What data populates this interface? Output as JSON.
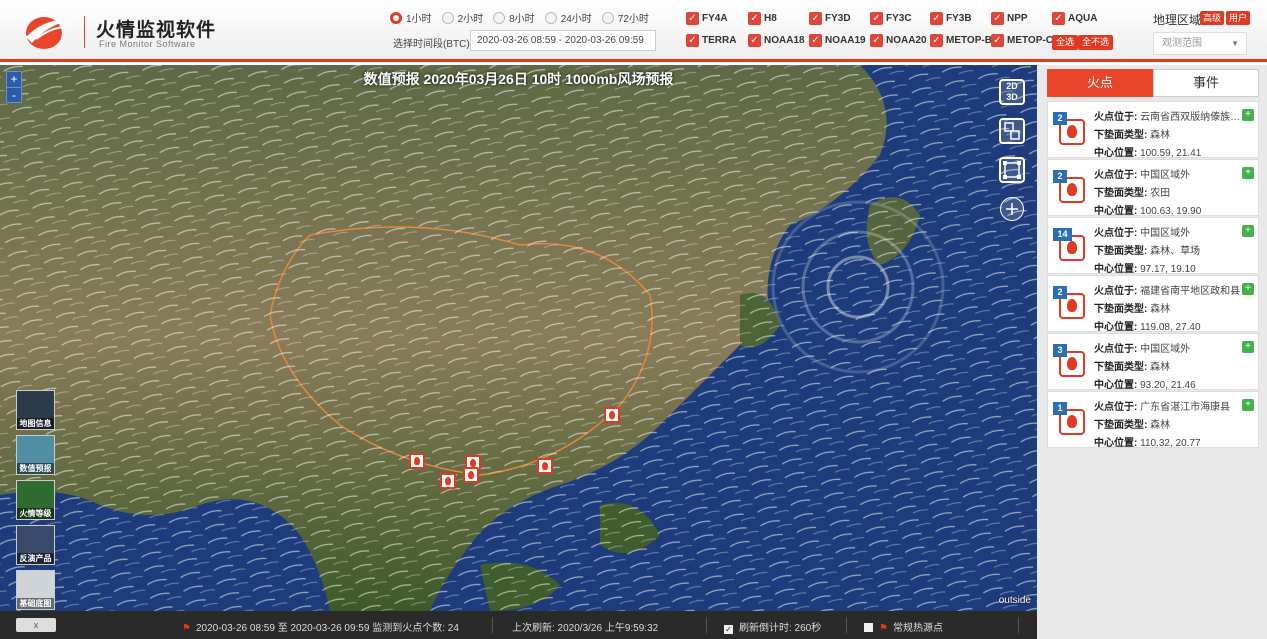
{
  "header": {
    "title_cn": "火情监视软件",
    "title_en": "Fire Monitor Software",
    "time_options": [
      {
        "label": "1小时",
        "selected": true
      },
      {
        "label": "2小时",
        "selected": false
      },
      {
        "label": "8小时",
        "selected": false
      },
      {
        "label": "24小时",
        "selected": false
      },
      {
        "label": "72小时",
        "selected": false
      }
    ],
    "period_label": "选择时间段(BTC)",
    "period_value": "2020-03-26 08:59 - 2020-03-26 09:59",
    "satellites": [
      "FY4A",
      "H8",
      "FY3D",
      "FY3C",
      "FY3B",
      "NPP",
      "AQUA",
      "TERRA",
      "NOAA18",
      "NOAA19",
      "NOAA20",
      "METOP-B",
      "METOP-C"
    ],
    "select_all": "全选",
    "select_none": "全不选",
    "geo_label": "地理区域",
    "geo_btn_1": "高级",
    "geo_btn_2": "用户",
    "range_placeholder": "观测范围",
    "accent": "#e03a22"
  },
  "map": {
    "title": "数值预报 2020年03月26日 10时 1000mb风场预报",
    "zoom_in": "+",
    "zoom_out": "-",
    "tool_2d3d": "2D 3D",
    "layers": [
      "地图信息",
      "数值预报",
      "火情等级",
      "反演产品",
      "基础底图"
    ],
    "outside_label": "outside"
  },
  "status": {
    "close_label": "x",
    "range_text": "2020-03-26 08:59 至 2020-03-26 09:59 监测到火点个数: 24",
    "last_refresh": "上次刷新:  2020/3/26 上午9:59:32",
    "countdown": "刷新倒计时: 260秒",
    "hotspot_label": "常规热源点"
  },
  "panel": {
    "tab_fire": "火点",
    "tab_event": "事件",
    "label_location": "火点位于:",
    "label_surface": "下垫面类型:",
    "label_center": "中心位置:",
    "fires": [
      {
        "count": "2",
        "location": "云南省西双版纳傣族自...",
        "surface": "森林",
        "center": "100.59, 21.41"
      },
      {
        "count": "2",
        "location": "中国区域外",
        "surface": "农田",
        "center": "100.63, 19.90"
      },
      {
        "count": "14",
        "location": "中国区域外",
        "surface": "森林、草场",
        "center": "97.17, 19.10"
      },
      {
        "count": "2",
        "location": "福建省南平地区政和县",
        "surface": "森林",
        "center": "119.08, 27.40"
      },
      {
        "count": "3",
        "location": "中国区域外",
        "surface": "森林",
        "center": "93.20, 21.46"
      },
      {
        "count": "1",
        "location": "广东省湛江市海康县",
        "surface": "森林",
        "center": "110.32, 20.77"
      }
    ]
  }
}
